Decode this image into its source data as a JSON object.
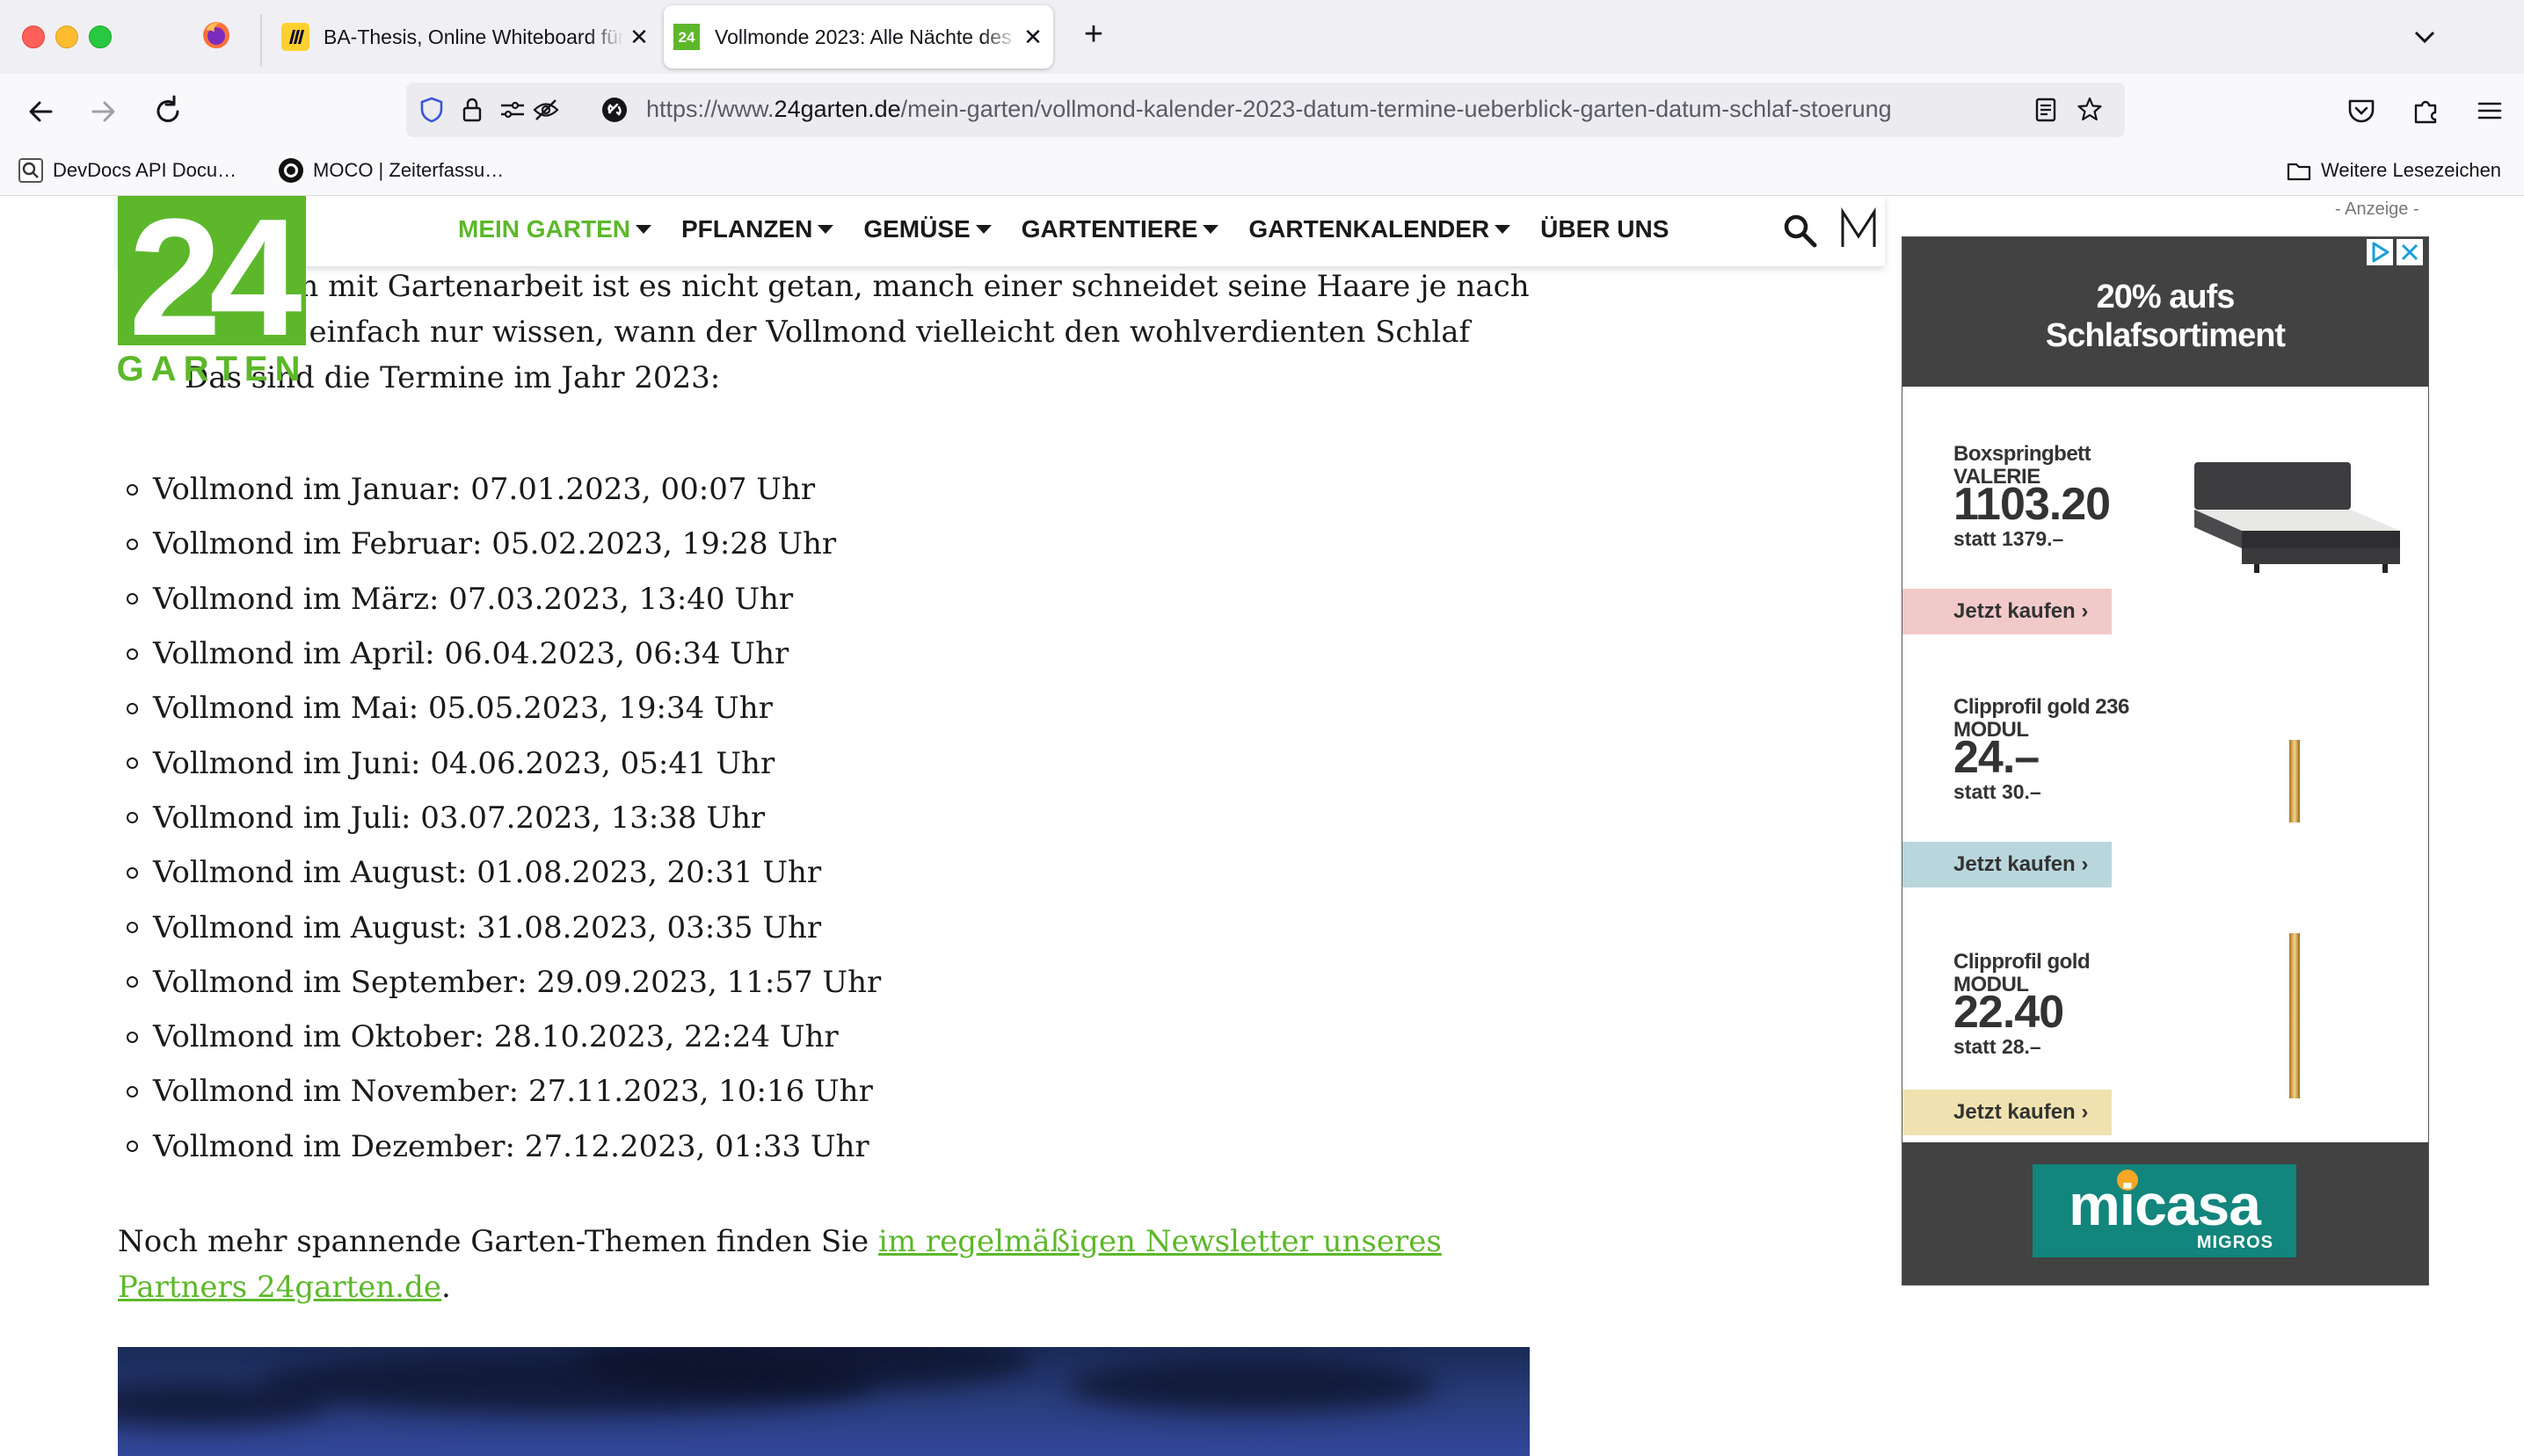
{
  "browser": {
    "tabs": [
      {
        "title": "BA-Thesis, Online Whiteboard für",
        "favicon": "miro-icon"
      },
      {
        "title": "Vollmonde 2023: Alle Nächte des",
        "favicon": "24garten-icon",
        "active": true
      }
    ],
    "url": {
      "prefix": "https://www.",
      "host": "24garten.de",
      "path": "/mein-garten/vollmond-kalender-2023-datum-termine-ueberblick-garten-datum-schlaf-stoerung"
    },
    "bookmarks": [
      {
        "label": "DevDocs API Docu…",
        "icon": "search-icon"
      },
      {
        "label": "MOCO | Zeiterfassu…",
        "icon": "moco-icon"
      }
    ],
    "other_bookmarks": "Weitere Lesezeichen"
  },
  "site": {
    "logo_text": "24",
    "logo_subtext": "GARTEN",
    "brand_color": "#5cb82a",
    "menu": [
      {
        "label": "MEIN GARTEN",
        "dropdown": true,
        "active": true
      },
      {
        "label": "PFLANZEN",
        "dropdown": true
      },
      {
        "label": "GEMÜSE",
        "dropdown": true
      },
      {
        "label": "GARTENTIERE",
        "dropdown": true
      },
      {
        "label": "GARTENKALENDER",
        "dropdown": true
      },
      {
        "label": "ÜBER UNS",
        "dropdown": false
      }
    ]
  },
  "article": {
    "intro_lines": [
      "en. Doch mit Gartenarbeit ist es nicht getan, manch einer schneidet seine Haare je nach",
      "der will einfach nur wissen, wann der Vollmond vielleicht den wohlverdienten Schlaf",
      "Das sind die Termine im Jahr 2023:"
    ],
    "full_moons": [
      "Vollmond im Januar: 07.01.2023, 00:07 Uhr",
      "Vollmond im Februar: 05.02.2023, 19:28 Uhr",
      "Vollmond im März: 07.03.2023, 13:40 Uhr",
      "Vollmond im April: 06.04.2023, 06:34 Uhr",
      "Vollmond im Mai: 05.05.2023, 19:34 Uhr",
      "Vollmond im Juni: 04.06.2023, 05:41 Uhr",
      "Vollmond im Juli: 03.07.2023, 13:38 Uhr",
      "Vollmond im August: 01.08.2023, 20:31 Uhr",
      "Vollmond im August: 31.08.2023, 03:35 Uhr",
      "Vollmond im September: 29.09.2023, 11:57 Uhr",
      "Vollmond im Oktober: 28.10.2023, 22:24 Uhr",
      "Vollmond im November: 27.11.2023, 10:16 Uhr",
      "Vollmond im Dezember: 27.12.2023, 01:33 Uhr"
    ],
    "outro_text": "Noch mehr spannende Garten-Themen finden Sie ",
    "outro_link": "im regelmäßigen Newsletter unseres Partners 24garten.de",
    "outro_end": "."
  },
  "ad": {
    "label": "- Anzeige -",
    "headline_line1": "20% aufs",
    "headline_line2": "Schlafsortiment",
    "products": [
      {
        "name_line1": "Boxspringbett",
        "name_line2": "VALERIE",
        "price": "1103.20",
        "was": "statt 1379.–",
        "cta": "Jetzt kaufen ›",
        "cta_color": "#f2c9c9",
        "image": "bed-icon"
      },
      {
        "name_line1": "Clipprofil gold 236",
        "name_line2": "MODUL",
        "price": "24.–",
        "was": "statt 30.–",
        "cta": "Jetzt kaufen ›",
        "cta_color": "#b9d6dd",
        "image": "gold-profile-icon"
      },
      {
        "name_line1": "Clipprofil gold",
        "name_line2": "MODUL",
        "price": "22.40",
        "was": "statt 28.–",
        "cta": "Jetzt kaufen ›",
        "cta_color": "#f0e2b0",
        "image": "gold-profile-icon"
      }
    ],
    "brand": "micasa",
    "brand_sub": "MIGROS"
  }
}
